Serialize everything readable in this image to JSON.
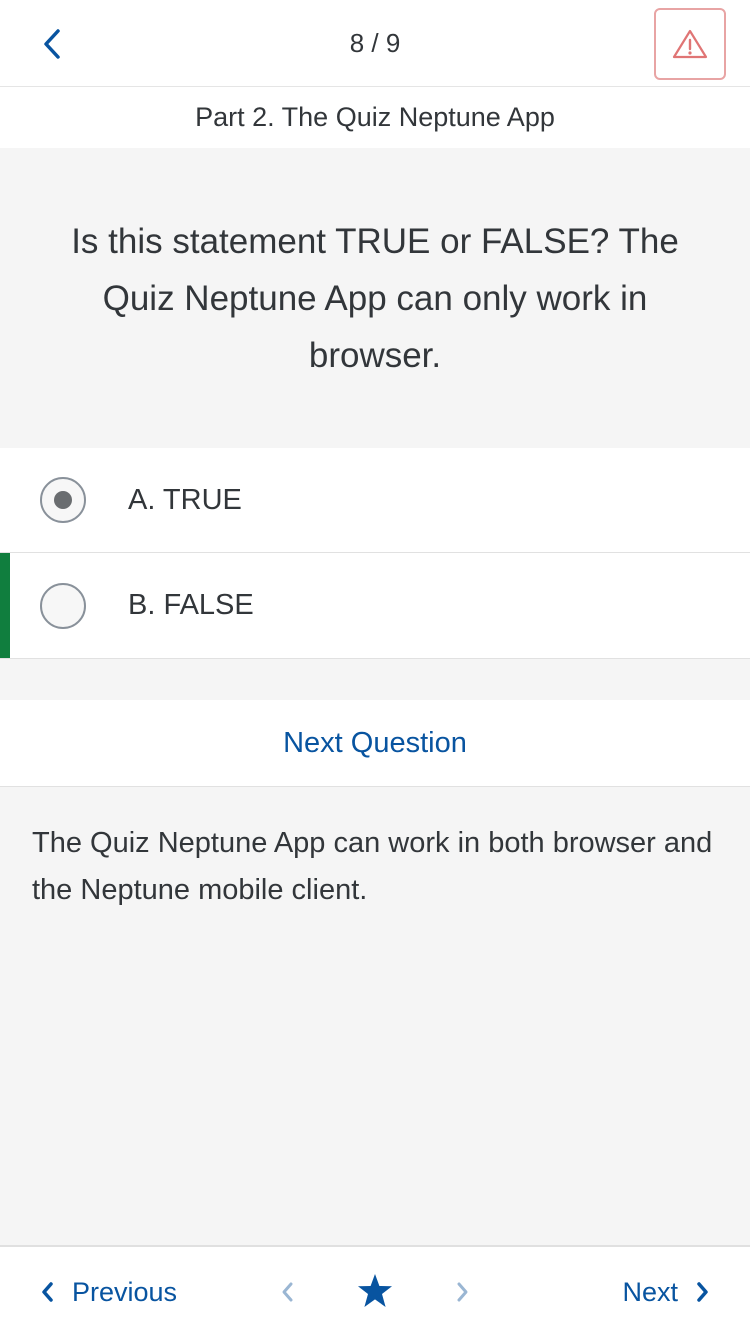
{
  "header": {
    "counter": "8 / 9",
    "back_icon": "chevron-left-icon",
    "report_icon": "warning-triangle-icon"
  },
  "subheader": {
    "title": "Part 2. The Quiz Neptune App"
  },
  "question": {
    "text": "Is this statement TRUE or FALSE? The Quiz Neptune App can only work in browser."
  },
  "options": [
    {
      "label": "A. TRUE",
      "selected": true,
      "correct": false
    },
    {
      "label": "B. FALSE",
      "selected": false,
      "correct": true
    }
  ],
  "next_question_label": "Next Question",
  "explanation": "The Quiz Neptune App can work in both browser and the Neptune mobile client.",
  "footer": {
    "previous_label": "Previous",
    "next_label": "Next",
    "star_icon": "star-icon"
  },
  "colors": {
    "accent": "#0854a0",
    "correct": "#107e3e",
    "warning_border": "#e8a4a4",
    "warning_icon": "#e07575"
  }
}
